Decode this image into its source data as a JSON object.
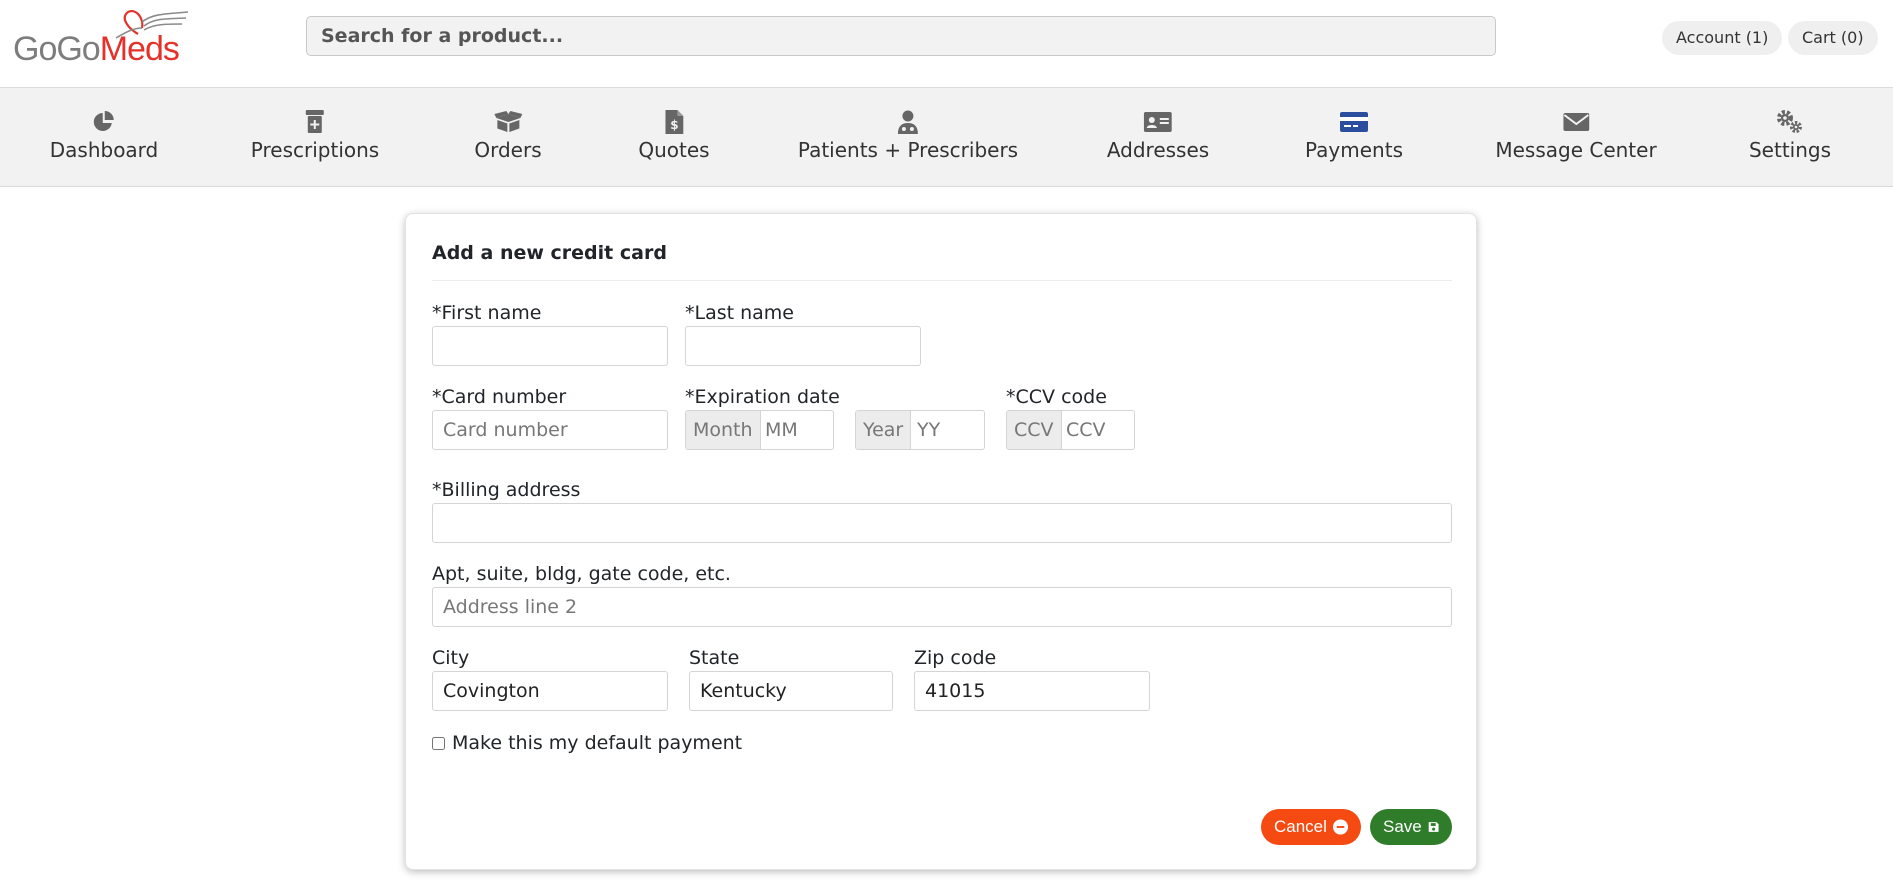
{
  "header": {
    "logo": {
      "part1": "GoGo",
      "part2": "Meds"
    },
    "search_placeholder": "Search for a product...",
    "account_label": "Account (1)",
    "cart_label": "Cart (0)"
  },
  "nav": {
    "items": [
      {
        "label": "Dashboard",
        "icon": "pie-chart-icon"
      },
      {
        "label": "Prescriptions",
        "icon": "pill-bottle-icon"
      },
      {
        "label": "Orders",
        "icon": "box-icon"
      },
      {
        "label": "Quotes",
        "icon": "invoice-dollar-icon"
      },
      {
        "label": "Patients + Prescribers",
        "icon": "doctor-icon"
      },
      {
        "label": "Addresses",
        "icon": "address-card-icon"
      },
      {
        "label": "Payments",
        "icon": "credit-card-icon",
        "active": true
      },
      {
        "label": "Message Center",
        "icon": "envelope-icon"
      },
      {
        "label": "Settings",
        "icon": "gears-icon"
      }
    ]
  },
  "form": {
    "title": "Add a new credit card",
    "first_name": {
      "label": "*First name",
      "value": ""
    },
    "last_name": {
      "label": "*Last name",
      "value": ""
    },
    "card_number": {
      "label": "*Card number",
      "placeholder": "Card number"
    },
    "expiration": {
      "label": "*Expiration date",
      "month_addon": "Month",
      "month_placeholder": "MM",
      "year_addon": "Year",
      "year_placeholder": "YY"
    },
    "ccv": {
      "label": "*CCV code",
      "addon": "CCV",
      "placeholder": "CCV"
    },
    "billing_address": {
      "label": "*Billing address",
      "value": ""
    },
    "address2": {
      "label": "Apt, suite, bldg, gate code, etc.",
      "placeholder": "Address line 2"
    },
    "city": {
      "label": "City",
      "value": "Covington"
    },
    "state": {
      "label": "State",
      "value": "Kentucky"
    },
    "zip": {
      "label": "Zip code",
      "value": "41015"
    },
    "default_payment_label": "Make this my default payment",
    "cancel_label": "Cancel",
    "save_label": "Save"
  },
  "colors": {
    "brand_red": "#e4322b",
    "cancel": "#f54a12",
    "save": "#2f7d2a",
    "active_nav_icon": "#2b4f9e"
  }
}
